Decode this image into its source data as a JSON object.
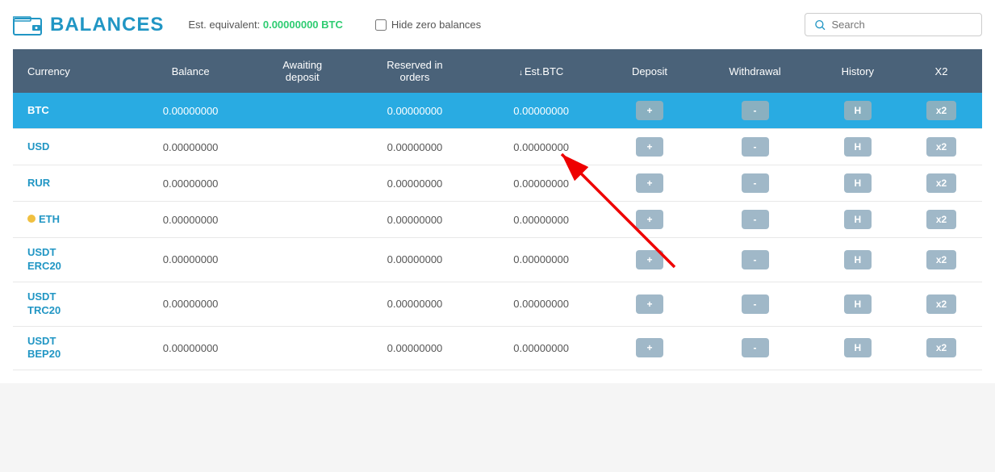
{
  "header": {
    "title": "BALANCES",
    "est_label": "Est. equivalent:",
    "est_value": "0.00000000 BTC",
    "hide_zero_label": "Hide zero balances",
    "search_placeholder": "Search"
  },
  "table": {
    "columns": [
      {
        "key": "currency",
        "label": "Currency"
      },
      {
        "key": "balance",
        "label": "Balance"
      },
      {
        "key": "awaiting",
        "label": "Awaiting deposit"
      },
      {
        "key": "reserved",
        "label": "Reserved in orders"
      },
      {
        "key": "estbtc",
        "label": "Est.BTC",
        "sortable": true
      },
      {
        "key": "deposit",
        "label": "Deposit"
      },
      {
        "key": "withdrawal",
        "label": "Withdrawal"
      },
      {
        "key": "history",
        "label": "History"
      },
      {
        "key": "x2",
        "label": "X2"
      }
    ],
    "rows": [
      {
        "currency": "BTC",
        "balance": "0.00000000",
        "awaiting": "",
        "reserved": "0.00000000",
        "estbtc": "0.00000000",
        "selected": true
      },
      {
        "currency": "USD",
        "balance": "0.00000000",
        "awaiting": "",
        "reserved": "0.00000000",
        "estbtc": "0.00000000",
        "selected": false
      },
      {
        "currency": "RUR",
        "balance": "0.00000000",
        "awaiting": "",
        "reserved": "0.00000000",
        "estbtc": "0.00000000",
        "selected": false
      },
      {
        "currency": "ETH",
        "balance": "0.00000000",
        "awaiting": "",
        "reserved": "0.00000000",
        "estbtc": "0.00000000",
        "selected": false,
        "eth_dot": true
      },
      {
        "currency": "USDT\nERC20",
        "balance": "0.00000000",
        "awaiting": "",
        "reserved": "0.00000000",
        "estbtc": "0.00000000",
        "selected": false
      },
      {
        "currency": "USDT\nTRC20",
        "balance": "0.00000000",
        "awaiting": "",
        "reserved": "0.00000000",
        "estbtc": "0.00000000",
        "selected": false
      },
      {
        "currency": "USDT\nBEP20",
        "balance": "0.00000000",
        "awaiting": "",
        "reserved": "0.00000000",
        "estbtc": "0.00000000",
        "selected": false
      }
    ],
    "buttons": {
      "deposit": "+",
      "withdrawal": "-",
      "history": "H",
      "x2": "x2"
    }
  }
}
